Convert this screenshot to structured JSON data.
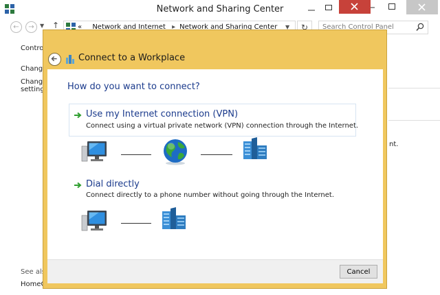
{
  "window": {
    "title": "Network and Sharing Center"
  },
  "toolbar": {
    "address_prefix": "«",
    "breadcrumbs": [
      "Network and Internet",
      "Network and Sharing Center"
    ],
    "search_placeholder": "Search Control Panel"
  },
  "sidebar": {
    "control_text": "Control",
    "change1": "Change",
    "change2_line1": "Change",
    "change2_line2": "settings",
    "see_also": "See also",
    "homegroup": "HomeG"
  },
  "right_fragment": "nt.",
  "dialog": {
    "title": "Connect to a Workplace",
    "question": "How do you want to connect?",
    "options": [
      {
        "title": "Use my Internet connection (VPN)",
        "description": "Connect using a virtual private network (VPN) connection through the Internet."
      },
      {
        "title": "Dial directly",
        "description": "Connect directly to a phone number without going through the Internet."
      }
    ],
    "cancel_label": "Cancel"
  },
  "colors": {
    "dialog_frame": "#f0c75e",
    "close_button": "#c7423a",
    "link_blue": "#1a3a8c",
    "arrow_green": "#2f9e2f"
  },
  "icons": [
    "app-icon",
    "back-arrow-icon",
    "forward-arrow-icon",
    "up-arrow-icon",
    "refresh-icon",
    "search-icon",
    "network-icon",
    "computer-icon",
    "globe-icon",
    "building-icon",
    "green-arrow-icon",
    "minimize-icon",
    "maximize-icon",
    "close-icon"
  ]
}
